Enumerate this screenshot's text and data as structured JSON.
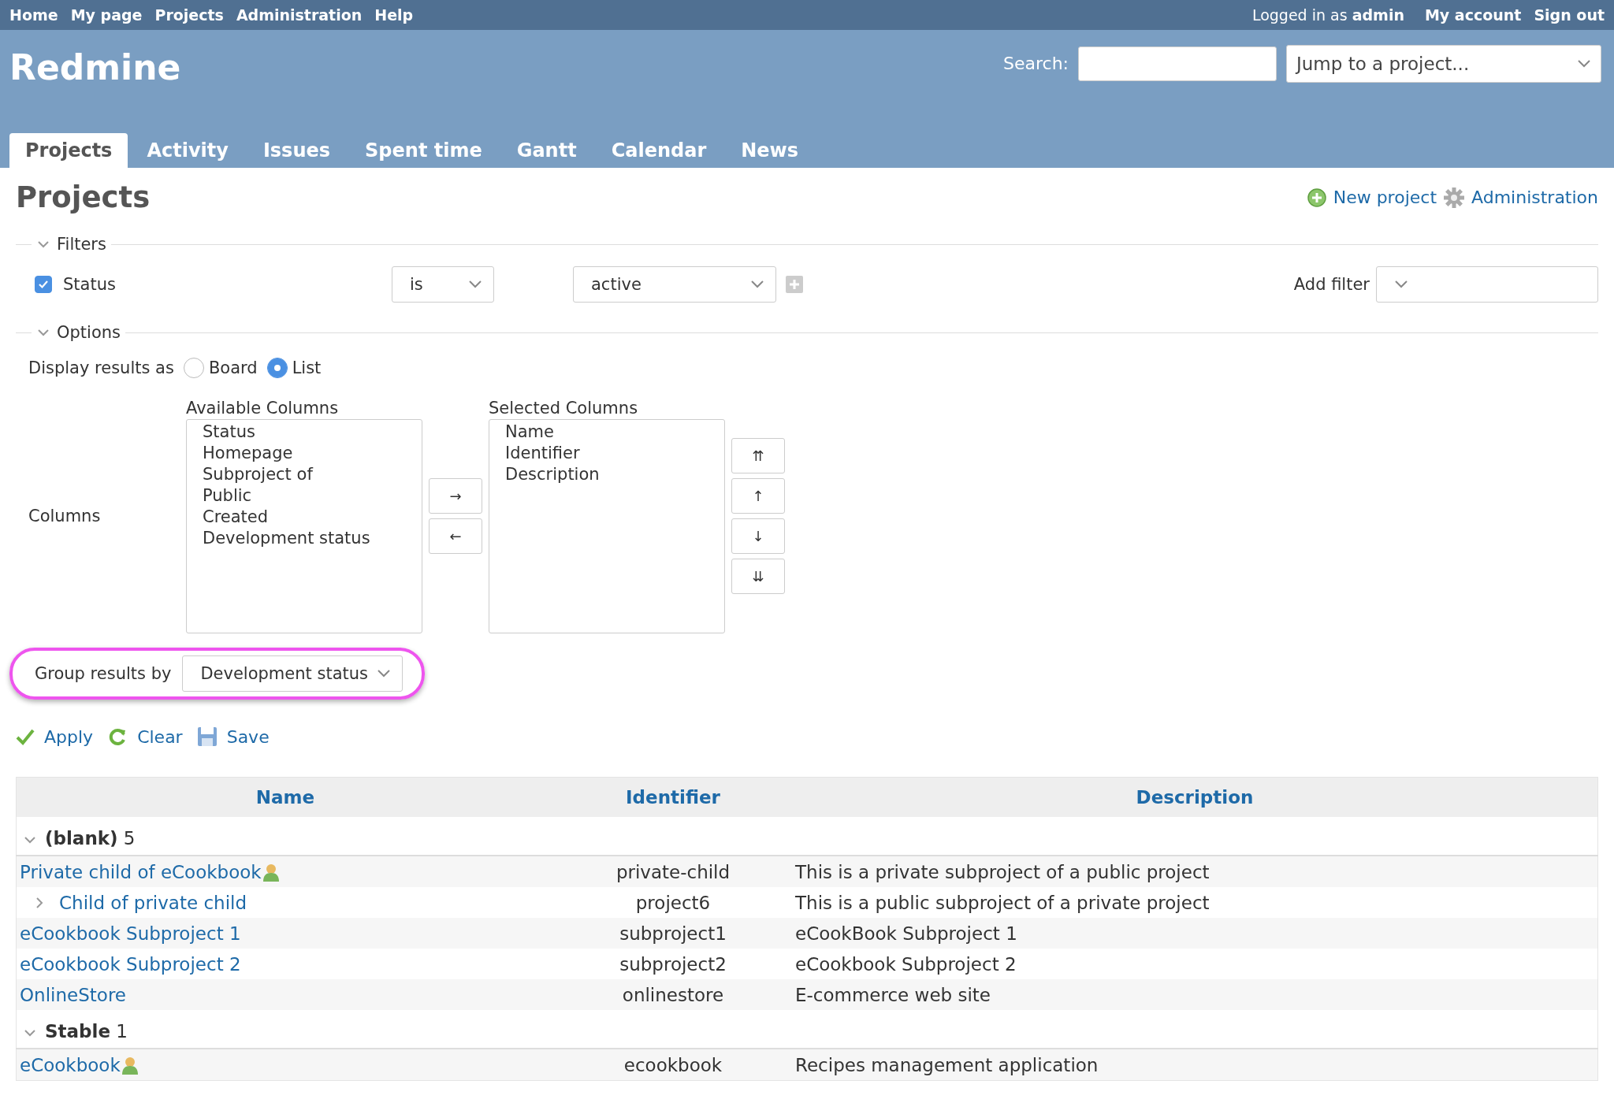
{
  "top_menu": {
    "left": [
      "Home",
      "My page",
      "Projects",
      "Administration",
      "Help"
    ],
    "logged_in_prefix": "Logged in as",
    "user": "admin",
    "right": [
      "My account",
      "Sign out"
    ]
  },
  "header": {
    "title": "Redmine",
    "search_label": "Search:",
    "jump": "Jump to a project..."
  },
  "tabs": [
    {
      "label": "Projects",
      "selected": true
    },
    {
      "label": "Activity",
      "selected": false
    },
    {
      "label": "Issues",
      "selected": false
    },
    {
      "label": "Spent time",
      "selected": false
    },
    {
      "label": "Gantt",
      "selected": false
    },
    {
      "label": "Calendar",
      "selected": false
    },
    {
      "label": "News",
      "selected": false
    }
  ],
  "page": {
    "title": "Projects",
    "actions": [
      {
        "kind": "new",
        "label": "New project"
      },
      {
        "kind": "admin",
        "label": "Administration"
      }
    ]
  },
  "filters": {
    "legend": "Filters",
    "expanded": true,
    "rows": [
      {
        "label": "Status",
        "checked": true,
        "operator": "is",
        "value": "active"
      }
    ],
    "add_filter_label": "Add filter"
  },
  "options": {
    "legend": "Options",
    "expanded": true,
    "display_label": "Display results as",
    "display_choices": [
      {
        "label": "Board",
        "selected": false
      },
      {
        "label": "List",
        "selected": true
      }
    ],
    "columns_label": "Columns",
    "available_label": "Available Columns",
    "available": [
      "Status",
      "Homepage",
      "Subproject of",
      "Public",
      "Created",
      "Development status"
    ],
    "selected_label": "Selected Columns",
    "selected": [
      "Name",
      "Identifier",
      "Description"
    ],
    "move_buttons": [
      "→",
      "←"
    ],
    "order_buttons": [
      "⇈",
      "↑",
      "↓",
      "⇊"
    ],
    "group_label": "Group results by",
    "group_value": "Development status",
    "highlighted": true
  },
  "buttons": [
    {
      "kind": "apply",
      "label": "Apply"
    },
    {
      "kind": "clear",
      "label": "Clear"
    },
    {
      "kind": "save",
      "label": "Save"
    }
  ],
  "table": {
    "columns": [
      "Name",
      "Identifier",
      "Description"
    ],
    "groups": [
      {
        "label": "(blank)",
        "count": "5",
        "expanded": true,
        "rows": [
          {
            "kind": "project",
            "name": "Private child of eCookbook",
            "member": true,
            "identifier": "private-child",
            "description": "This is a private subproject of a public project"
          },
          {
            "kind": "child",
            "name": "Child of private child",
            "member": false,
            "identifier": "project6",
            "description": "This is a public subproject of a private project"
          },
          {
            "kind": "project",
            "name": "eCookbook Subproject 1",
            "member": false,
            "identifier": "subproject1",
            "description": "eCookBook Subproject 1"
          },
          {
            "kind": "project",
            "name": "eCookbook Subproject 2",
            "member": false,
            "identifier": "subproject2",
            "description": "eCookbook Subproject 2"
          },
          {
            "kind": "project",
            "name": "OnlineStore",
            "member": false,
            "identifier": "onlinestore",
            "description": "E-commerce web site"
          }
        ]
      },
      {
        "label": "Stable",
        "count": "1",
        "expanded": true,
        "rows": [
          {
            "kind": "project",
            "name": "eCookbook",
            "member": true,
            "identifier": "ecookbook",
            "description": "Recipes management application"
          }
        ]
      }
    ]
  }
}
